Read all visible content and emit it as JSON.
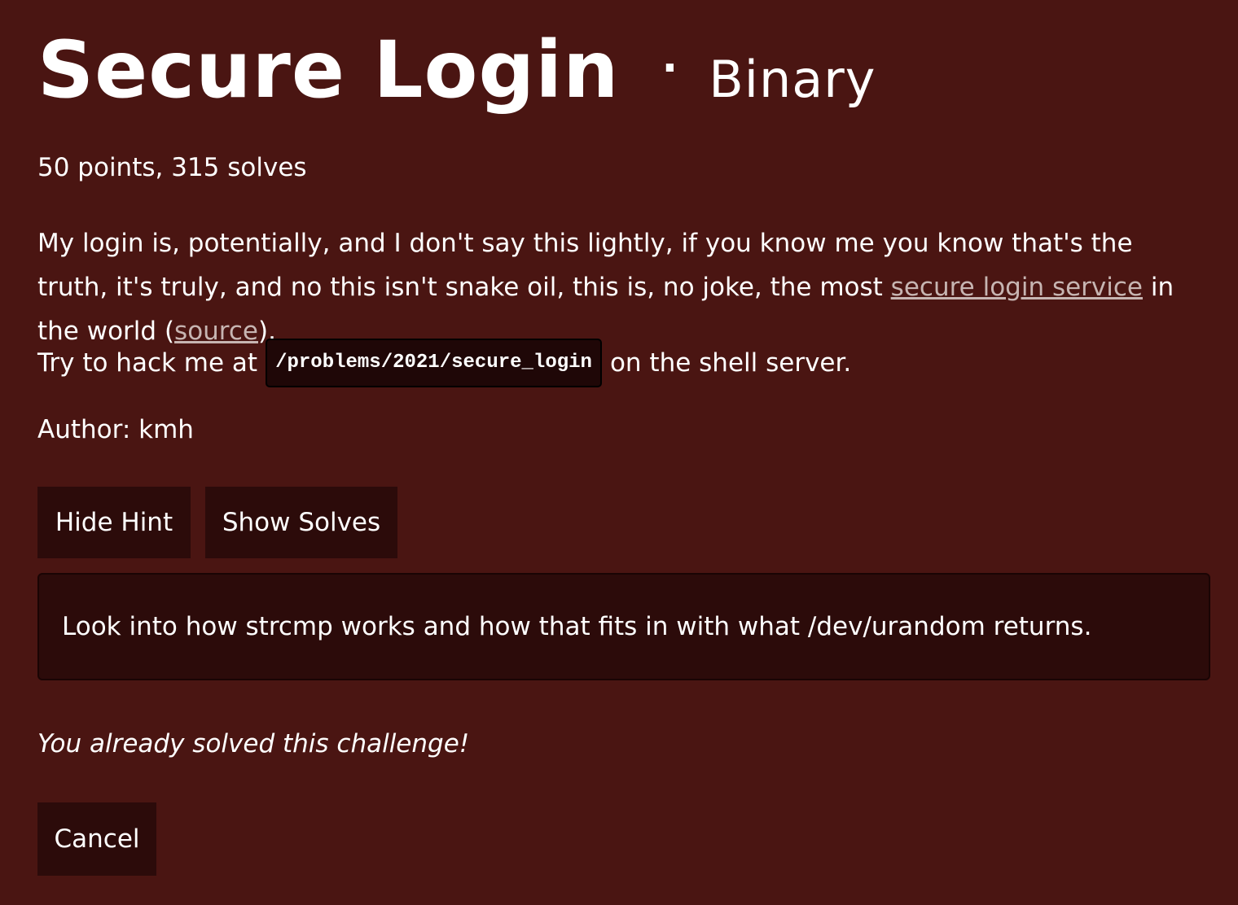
{
  "challenge": {
    "title": "Secure Login",
    "separator": "·",
    "category": "Binary",
    "points_line": "50 points, 315 solves",
    "description": {
      "text_before_link": "My login is, potentially, and I don't say this lightly, if you know me you know that's the truth, it's truly, and no this isn't snake oil, this is, no joke, the most ",
      "link_service": "secure login service",
      "text_middle": " in the world (",
      "link_source": "source",
      "text_end": ")."
    },
    "shell": {
      "prefix": "Try to hack me at",
      "path": "/problems/2021/secure_login",
      "suffix": "on the shell server."
    },
    "author": "Author: kmh"
  },
  "buttons": {
    "hide_hint": "Hide Hint",
    "show_solves": "Show Solves",
    "cancel": "Cancel"
  },
  "hint": {
    "text": "Look into how strcmp works and how that fits in with what /dev/urandom returns."
  },
  "status": {
    "solved_message": "You already solved this challenge!"
  },
  "colors": {
    "background": "#4a1512",
    "button_background": "#2c0b0a",
    "link": "#c7b5b2"
  }
}
